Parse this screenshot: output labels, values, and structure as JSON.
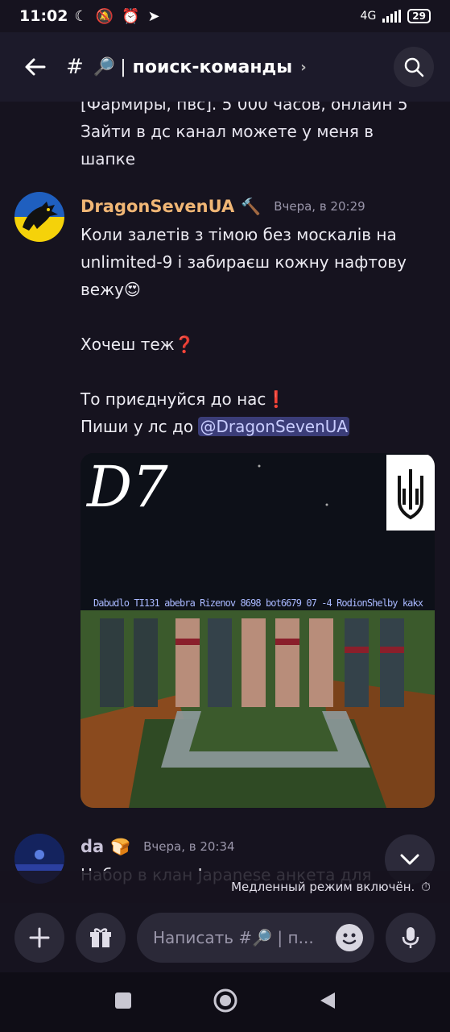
{
  "status_bar": {
    "time": "11:02",
    "network": "4G",
    "battery": "29"
  },
  "header": {
    "channel_hash": "#",
    "channel_emoji": "🔎",
    "channel_separator": "|",
    "channel_name": "поиск-команды",
    "chevron": "›"
  },
  "previous_message": {
    "cut_line": "[Фармиры, пвс]. 5 000 часов, онлайн 5",
    "lines": [
      "Зайти в дс канал можете у меня в",
      "шапке"
    ]
  },
  "message": {
    "author": "DragonSevenUA",
    "role_icon": "hammer-icon",
    "timestamp": "Вчера, в 20:29",
    "line1": "Коли залетів з тімою без москалів на",
    "line2": "unlimited-9 і забираєш кожну нафтову",
    "line3": "вежу",
    "line3_emoji": "😍",
    "line4": "Хочеш теж",
    "line4_emoji": "❓",
    "line5": "То приєднуйся до нас",
    "line5_emoji": "❗",
    "line6": "Пиши у лс до ",
    "mention": "@DragonSevenUA",
    "image": {
      "logo_text": "D7",
      "nametags": "Dabudlo TI131 abebra Rizenov 8698 bot6679 07 -4 RodionShelby kakx"
    }
  },
  "next_message": {
    "author": "da",
    "timestamp": "Вчера, в 20:34",
    "preview": "Набор в клан Japanese анкета для"
  },
  "slow_mode": {
    "text": "Медленный режим включён."
  },
  "composer": {
    "placeholder": "Написать #🔎 | п..."
  },
  "colors": {
    "background": "#16131f",
    "username": "#f0b675",
    "mention_bg": "#3b3d78",
    "button_bg": "#2b2938"
  }
}
